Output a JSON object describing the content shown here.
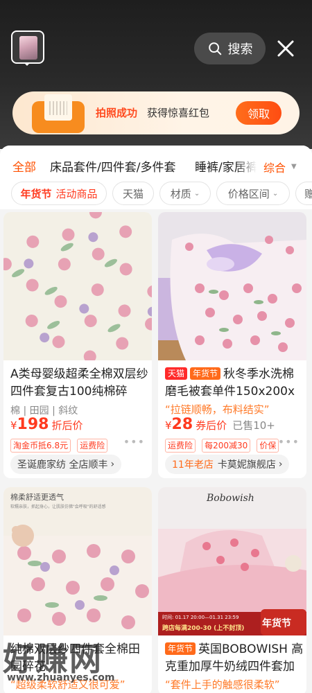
{
  "header": {
    "search_label": "搜索",
    "search_icon": "search-icon",
    "close_icon": "close-icon"
  },
  "banner": {
    "title": "拍照成功",
    "subtitle": "获得惊喜红包",
    "button": "领取"
  },
  "tabs": {
    "items": [
      "全部",
      "床品套件/四件套/多件套",
      "睡裤/家居裤"
    ],
    "sort_label": "综合"
  },
  "filters": {
    "promo_bold": "年货节",
    "promo_label": "活动商品",
    "chips": [
      "天猫",
      "材质",
      "价格区间",
      "赠"
    ]
  },
  "products": [
    {
      "title": "A类母婴级超柔全棉双层纱四件套复古100纯棉碎",
      "attrs": "棉 | 田园 | 斜纹",
      "yen": "¥",
      "price": "198",
      "price_label": "折后价",
      "sold": "",
      "tags": [
        "淘金币抵6.8元",
        "运费险"
      ],
      "shop": "圣诞鹿家纺 全店顺丰",
      "shop_badge": ""
    },
    {
      "badge_tmall": "天猫",
      "badge_festival": "年货节",
      "title": "秋冬季水洗棉磨毛被套单件150x200x",
      "quote": "“拉链顺畅，布料结实”",
      "yen": "¥",
      "price": "28",
      "price_label": "券后价",
      "sold": "已售10+",
      "tags": [
        "运费险",
        "每200减30",
        "价保"
      ],
      "shop_badge": "11年老店",
      "shop": "卡莫妮旗舰店"
    },
    {
      "photo_text": "棉柔舒适更透气",
      "photo_subtext": "软糯亲肤，抓起身心，让肌肤仿佛\"会呼吸\"的舒适感",
      "title": "纯棉双层纱四件套全棉田园碎花",
      "quote": "“超级柔软舒适又很可爱”"
    },
    {
      "photo_brand": "Bobowish",
      "photo_promo": "跨店每满200-30 (上不封顶)",
      "photo_time": "时间: 01.17 20:00—01.31 23:59",
      "photo_badge": "年货节",
      "badge_festival": "年货节",
      "title": "英国BOBOWISH 高克重加厚牛奶绒四件套加",
      "quote": "“套件上手的触感很柔软”"
    }
  ],
  "watermark": {
    "big": "好赚网",
    "small": "www.zhuanyes.com"
  }
}
